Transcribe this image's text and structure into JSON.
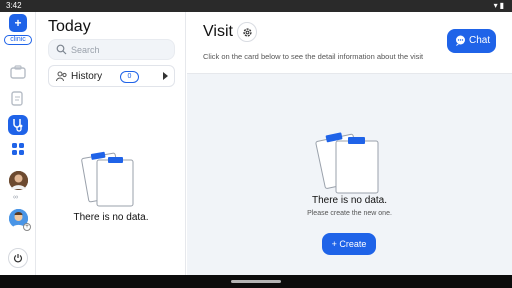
{
  "status_bar": {
    "time": "3:42",
    "icons": [
      "wifi-icon",
      "battery-icon"
    ]
  },
  "rail": {
    "logo_glyph": "+",
    "logo_text": "clinic",
    "items": [
      {
        "name": "folder-icon",
        "active": false
      },
      {
        "name": "document-icon",
        "active": false
      },
      {
        "name": "stethoscope-icon",
        "active": true
      },
      {
        "name": "apps-grid-icon",
        "active": false
      }
    ],
    "avatar_badge": "+",
    "power_icon": "power-icon"
  },
  "left": {
    "title": "Today",
    "search_placeholder": "Search",
    "history_label": "History",
    "history_count": "0",
    "empty_text": "There is no data."
  },
  "main": {
    "title": "Visit",
    "subtitle": "Click on the card below to see the detail information about the visit",
    "chat_label": "Chat",
    "empty_text": "There is no data.",
    "empty_hint": "Please create the new one.",
    "create_label": "+ Create"
  },
  "colors": {
    "accent": "#1f63e8",
    "panel": "#f1f4f8"
  }
}
